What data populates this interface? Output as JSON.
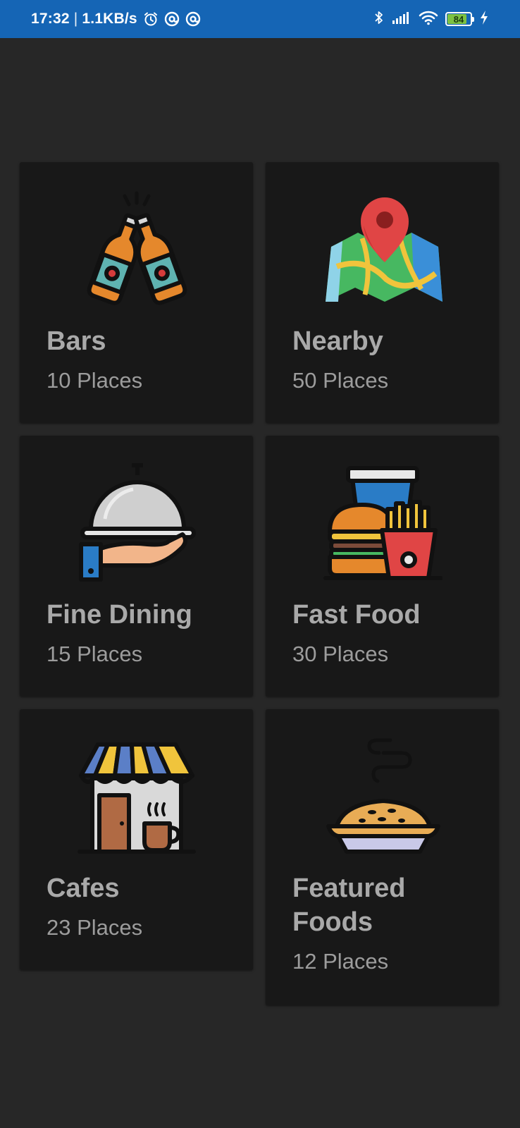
{
  "status_bar": {
    "time": "17:32",
    "separator": "|",
    "network_speed": "1.1KB/s",
    "battery_level": "84",
    "battery_fraction": 0.84,
    "icons": [
      "alarm-icon",
      "at-sign-icon",
      "at-sign-icon",
      "bluetooth-icon",
      "cell-signal-icon",
      "wifi-icon",
      "battery-icon",
      "charging-icon"
    ]
  },
  "categories": [
    {
      "icon": "beer-bottles-icon",
      "title": "Bars",
      "count": "10 Places"
    },
    {
      "icon": "map-pin-icon",
      "title": "Nearby",
      "count": "50 Places"
    },
    {
      "icon": "serving-cloche-icon",
      "title": "Fine Dining",
      "count": "15 Places"
    },
    {
      "icon": "burger-fries-icon",
      "title": "Fast Food",
      "count": "30 Places"
    },
    {
      "icon": "cafe-storefront-icon",
      "title": "Cafes",
      "count": "23 Places"
    },
    {
      "icon": "pie-icon",
      "title": "Featured Foods",
      "count": "12 Places"
    }
  ],
  "colors": {
    "status_bar": "#1565b5",
    "background": "#272727",
    "card": "#181818",
    "title_text": "#a9a9a9",
    "subtitle_text": "#9c9c9c",
    "battery_fill": "#7dc242"
  }
}
